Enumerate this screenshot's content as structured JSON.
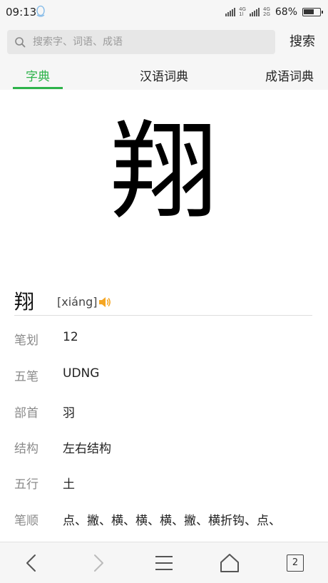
{
  "status_bar": {
    "time": "09:13",
    "network": "4G",
    "battery_percent": "68%",
    "battery_level": 0.68
  },
  "search": {
    "placeholder": "搜索字、词语、成语",
    "button_label": "搜索"
  },
  "tabs": [
    {
      "label": "字典",
      "active": true
    },
    {
      "label": "汉语词典",
      "active": false
    },
    {
      "label": "成语词典",
      "active": false
    }
  ],
  "entry": {
    "character": "翔",
    "pinyin": "[xiáng]"
  },
  "info_rows": [
    {
      "label": "笔划",
      "value": "12"
    },
    {
      "label": "五笔",
      "value": "UDNG"
    },
    {
      "label": "部首",
      "value": "羽"
    },
    {
      "label": "结构",
      "value": "左右结构"
    },
    {
      "label": "五行",
      "value": "土"
    },
    {
      "label": "笔顺",
      "value": "点、撇、横、横、横、撇、横折钩、点、"
    }
  ],
  "bottom_nav": {
    "tab_count": "2"
  },
  "colors": {
    "accent": "#2db34a",
    "speaker": "#f5a623"
  }
}
